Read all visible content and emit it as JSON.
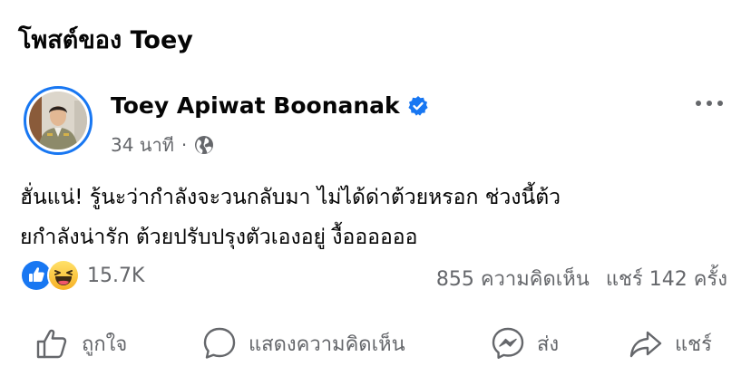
{
  "header": {
    "title": "โพสต์ของ Toey"
  },
  "post": {
    "author": "Toey Apiwat Boonanak",
    "time": "34 นาที",
    "separator": "·",
    "text_lines": [
      "ฮั่นแน่!  รู้นะว่ากำลังจะวนกลับมา ไม่ได้ด่าต้วยหรอก ช่วงนี้ต้ว",
      "ยกำลังน่ารัก ต้วยปรับปรุงตัวเองอยู่ งื้ออออออ"
    ],
    "reactions_count": "15.7K",
    "comments": "855 ความคิดเห็น",
    "shares": "แชร์ 142 ครั้ง"
  },
  "actions": {
    "like": "ถูกใจ",
    "comment": "แสดงความคิดเห็น",
    "send": "ส่ง",
    "share": "แชร์"
  },
  "icons": {
    "verified": "verified-badge-icon",
    "audience": "globe-icon",
    "more": "more-options-icon",
    "reaction_like": "like-reaction-icon",
    "reaction_haha": "haha-reaction-icon"
  },
  "colors": {
    "accent": "#1877f2",
    "secondary_text": "#65676b",
    "primary_text": "#050505"
  }
}
